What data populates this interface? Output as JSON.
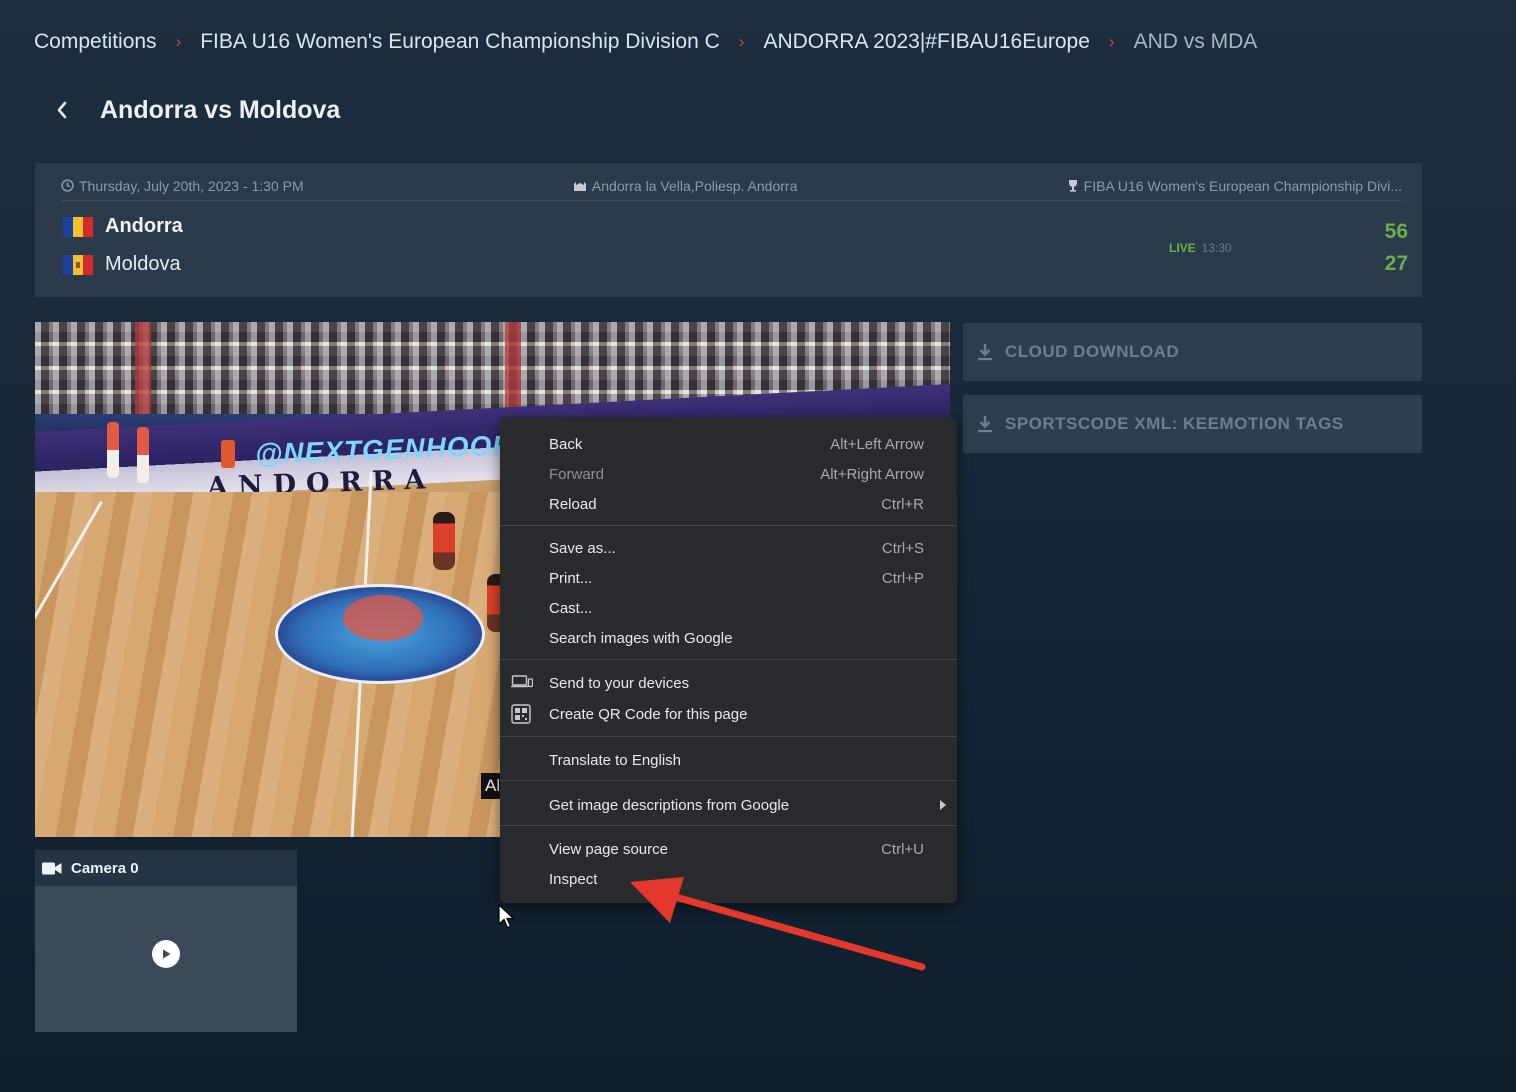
{
  "breadcrumb": {
    "items": [
      "Competitions",
      "FIBA U16 Women's European Championship Division C",
      "ANDORRA 2023|#FIBAU16Europe",
      "AND vs MDA"
    ],
    "separator": "›"
  },
  "page": {
    "title": "Andorra vs Moldova"
  },
  "match": {
    "datetime": "Thursday, July 20th, 2023 - 1:30 PM",
    "venue": "Andorra la Vella,Poliesp. Andorra",
    "competition": "FIBA U16 Women's European Championship Divi...",
    "home": {
      "name": "Andorra",
      "score": "56",
      "flag_colors": [
        "#1d3f9e",
        "#f2c12e",
        "#d42a2a"
      ]
    },
    "away": {
      "name": "Moldova",
      "score": "27",
      "flag_colors": [
        "#1d3f9e",
        "#f2c12e",
        "#d42a2a"
      ]
    },
    "status": "LIVE",
    "clock": "13:30"
  },
  "video": {
    "banner_handle": "@NEXTGENHOOP",
    "banner_city": "ANDORRA",
    "tag": "Al"
  },
  "camera": {
    "label": "Camera 0"
  },
  "actions": {
    "cloud_download": "CLOUD DOWNLOAD",
    "sportscode": "SPORTSCODE XML: KEEMOTION TAGS"
  },
  "context_menu": {
    "back": {
      "label": "Back",
      "shortcut": "Alt+Left Arrow"
    },
    "forward": {
      "label": "Forward",
      "shortcut": "Alt+Right Arrow"
    },
    "reload": {
      "label": "Reload",
      "shortcut": "Ctrl+R"
    },
    "save_as": {
      "label": "Save as...",
      "shortcut": "Ctrl+S"
    },
    "print": {
      "label": "Print...",
      "shortcut": "Ctrl+P"
    },
    "cast": {
      "label": "Cast..."
    },
    "search_images": {
      "label": "Search images with Google"
    },
    "send_devices": {
      "label": "Send to your devices"
    },
    "qr_code": {
      "label": "Create QR Code for this page"
    },
    "translate": {
      "label": "Translate to English"
    },
    "image_descriptions": {
      "label": "Get image descriptions from Google"
    },
    "view_source": {
      "label": "View page source",
      "shortcut": "Ctrl+U"
    },
    "inspect": {
      "label": "Inspect"
    }
  },
  "colors": {
    "accent_live": "#6ab04c",
    "breadcrumb_separator": "#d8453c",
    "annotation_arrow": "#e5382c"
  }
}
